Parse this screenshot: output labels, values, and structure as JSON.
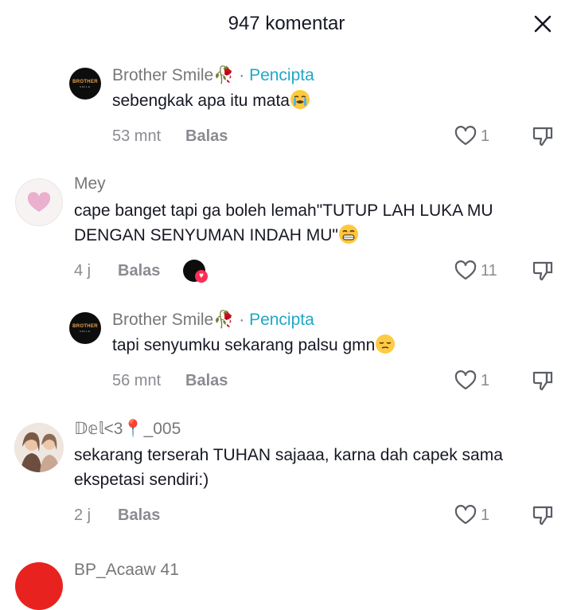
{
  "header": {
    "title": "947 komentar",
    "close_icon": "close-icon"
  },
  "comments": [
    {
      "username": "Brother Smile",
      "separator": "·",
      "creator_label": "Pencipta",
      "avatar_text": "BROTHER",
      "avatar_subtext": "SMILE",
      "text": "sebengkak apa itu mata",
      "emoji": "loudly-crying-face",
      "time": "53 mnt",
      "reply": "Balas",
      "likes": "1"
    },
    {
      "username": "Mey",
      "text": "cape banget tapi ga boleh lemah\"TUTUP LAH LUKA MU DENGAN SENYUMAN INDAH MU\"",
      "emoji": "grinning-face",
      "time": "4 j",
      "reply": "Balas",
      "likes": "11",
      "liked_by_creator": true
    },
    {
      "username": "Brother Smile",
      "separator": "·",
      "creator_label": "Pencipta",
      "avatar_text": "BROTHER",
      "avatar_subtext": "SMILE",
      "text": "tapi senyumku sekarang palsu gmn",
      "emoji": "pensive-face",
      "time": "56 mnt",
      "reply": "Balas",
      "likes": "1"
    },
    {
      "username": "𝔻𝕖𝕝<3📍_005",
      "text": "sekarang terserah TUHAN sajaaa, karna dah capek sama ekspetasi sendiri:)",
      "time": "2 j",
      "reply": "Balas",
      "likes": "1"
    },
    {
      "username": "BP_Acaaw 41"
    }
  ],
  "colors": {
    "creator": "#1fa8c8",
    "username": "#767878",
    "meta": "#8a8b91",
    "text": "#161823",
    "heart": "#fe2c55"
  }
}
